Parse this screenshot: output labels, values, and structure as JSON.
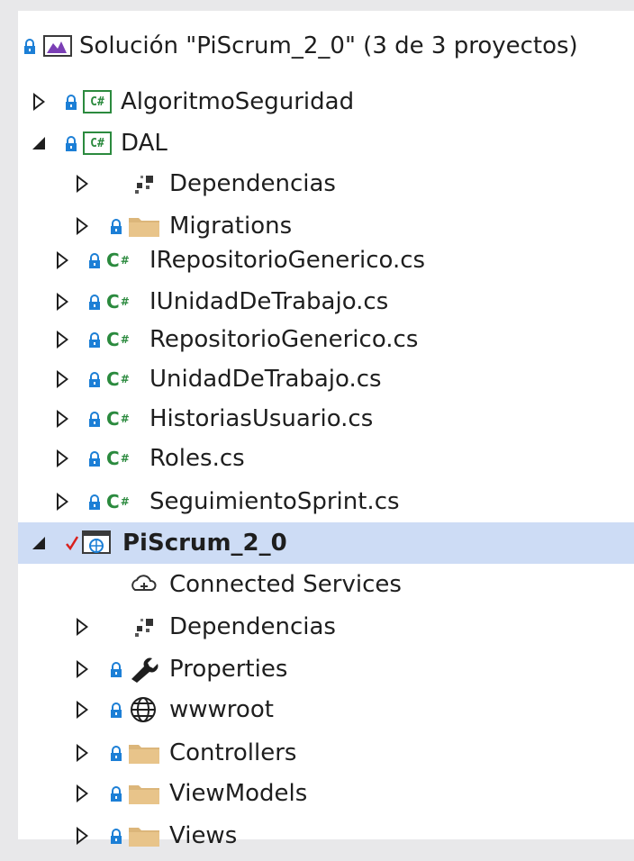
{
  "solution": {
    "label": "Solución \"PiScrum_2_0\" (3 de 3 proyectos)"
  },
  "tree": [
    {
      "label": "AlgoritmoSeguridad",
      "icon": "csharp-project-icon",
      "lock": true,
      "expander": "collapsed"
    },
    {
      "label": "DAL",
      "icon": "csharp-project-icon",
      "lock": true,
      "expander": "expanded"
    },
    {
      "label": "Dependencias",
      "icon": "dependencies-icon",
      "lock": false,
      "expander": "collapsed"
    },
    {
      "label": "Migrations",
      "icon": "folder-icon",
      "lock": true,
      "expander": "collapsed"
    },
    {
      "label": "IRepositorioGenerico.cs",
      "icon": "csharp-file-icon",
      "lock": true,
      "expander": "collapsed"
    },
    {
      "label": "IUnidadDeTrabajo.cs",
      "icon": "csharp-file-icon",
      "lock": true,
      "expander": "collapsed"
    },
    {
      "label": "RepositorioGenerico.cs",
      "icon": "csharp-file-icon",
      "lock": true,
      "expander": "collapsed"
    },
    {
      "label": "UnidadDeTrabajo.cs",
      "icon": "csharp-file-icon",
      "lock": true,
      "expander": "collapsed"
    },
    {
      "label": "HistoriasUsuario.cs",
      "icon": "csharp-file-icon",
      "lock": true,
      "expander": "collapsed"
    },
    {
      "label": "Roles.cs",
      "icon": "csharp-file-icon",
      "lock": true,
      "expander": "collapsed"
    },
    {
      "label": "SeguimientoSprint.cs",
      "icon": "csharp-file-icon",
      "lock": true,
      "expander": "collapsed"
    },
    {
      "label": "PiScrum_2_0",
      "icon": "web-project-icon",
      "lock": false,
      "checkmark": true,
      "expander": "expanded",
      "selected": true
    },
    {
      "label": "Connected Services",
      "icon": "connected-services-icon",
      "lock": false,
      "expander": "none"
    },
    {
      "label": "Dependencias",
      "icon": "dependencies-icon",
      "lock": false,
      "expander": "collapsed"
    },
    {
      "label": "Properties",
      "icon": "wrench-icon",
      "lock": true,
      "expander": "collapsed"
    },
    {
      "label": "wwwroot",
      "icon": "globe-icon",
      "lock": true,
      "expander": "collapsed"
    },
    {
      "label": "Controllers",
      "icon": "folder-icon",
      "lock": true,
      "expander": "collapsed"
    },
    {
      "label": "ViewModels",
      "icon": "folder-icon",
      "lock": true,
      "expander": "collapsed"
    },
    {
      "label": "Views",
      "icon": "folder-icon",
      "lock": true,
      "expander": "collapsed"
    }
  ],
  "colors": {
    "selection": "#cddcf5",
    "csharp": "#2b8a3e",
    "lock": "#1c7fd6",
    "folder": "#dcb67a",
    "check": "#d9201d"
  }
}
